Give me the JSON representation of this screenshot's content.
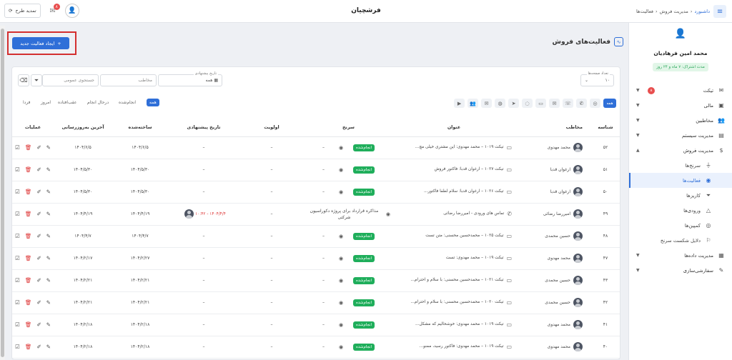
{
  "topbar": {
    "brand": "فرشچیان",
    "breadcrumb": [
      "داشبورد",
      "مدیریت فروش",
      "فعالیت‌ها"
    ],
    "update_label": "تمدید طرح",
    "mail_count": "۸"
  },
  "sidebar": {
    "user_name": "محمد امین فرهادیان",
    "user_status": "مدت اشتراک: ۷ ماه و ۲۴ روز",
    "items": [
      {
        "label": "تیکت",
        "icon": "ticket-icon",
        "badge": "۸"
      },
      {
        "label": "مالی",
        "icon": "finance-icon"
      },
      {
        "label": "مخاطبین",
        "icon": "contacts-icon"
      },
      {
        "label": "مدیریت سیستم",
        "icon": "system-icon"
      },
      {
        "label": "مدیریت فروش",
        "icon": "sales-icon"
      },
      {
        "label": "سرنخ‌ها",
        "icon": "funnel-icon"
      },
      {
        "label": "فعالیت‌ها",
        "icon": "lightbulb-icon"
      },
      {
        "label": "کاریزها",
        "icon": "pipeline-icon"
      },
      {
        "label": "ورودی‌ها",
        "icon": "inbox-icon"
      },
      {
        "label": "کمپین‌ها",
        "icon": "campaign-icon"
      },
      {
        "label": "دلایل شکست سرنخ",
        "icon": "flag-icon"
      },
      {
        "label": "مدیریت داده‌ها",
        "icon": "data-icon"
      },
      {
        "label": "سفارشی‌سازی",
        "icon": "customize-icon"
      }
    ]
  },
  "page": {
    "title": "فعالیت‌های فروش",
    "new_button": "ایجاد فعالیت جدید"
  },
  "filters": {
    "page_size_label": "تعداد صفحه‌ها",
    "page_size": "۱۰",
    "date_label": "تاریخ پیشنهادی",
    "date_value": "همه",
    "contact_placeholder": "مخاطب",
    "search_placeholder": "جستجوی عمومی"
  },
  "channels": {
    "all": "همه"
  },
  "status_tabs": [
    "همه",
    "انجام‌شده",
    "در‌حال انجام",
    "عقب‌افتاده",
    "امروز",
    "فردا"
  ],
  "table": {
    "headers": {
      "id": "شناسه",
      "contact": "مخاطب",
      "title": "عنوان",
      "lead": "سرنخ",
      "priority": "اولویت",
      "suggested": "تاریخ پیشنهادی",
      "created": "ساخته‌شده",
      "updated": "آخرین به‌روزرسانی",
      "ops": "عملیات"
    },
    "rows": [
      {
        "id": "۵۲",
        "contact": "محمد مهدوی",
        "title": "تیکت ۱۰۱۹ – محمد مهدوی: این مشتری خیلی مچ...",
        "status": "انجام‌شده",
        "lead": "–",
        "priority": "–",
        "suggested": "–",
        "created": "۱۴۰۴/۶/۵",
        "updated": "۱۴۰۴/۶/۵"
      },
      {
        "id": "۵۱",
        "contact": "ارغوان قدبا",
        "title": "تیکت ۱۰۲۷ – ارغوان قدبا: فاکتور فروش",
        "status": "انجام‌شده",
        "lead": "–",
        "priority": "–",
        "suggested": "–",
        "created": "۱۴۰۴/۵/۳۰",
        "updated": "۱۴۰۴/۵/۳۰"
      },
      {
        "id": "۵۰",
        "contact": "ارغوان قدبا",
        "title": "تیکت ۱۰۲۶ – ارغوان قدبا: سلام لطفا فاکتور...",
        "status": "انجام‌شده",
        "lead": "–",
        "priority": "–",
        "suggested": "–",
        "created": "۱۴۰۴/۵/۳۰",
        "updated": "۱۴۰۴/۵/۳۰"
      },
      {
        "id": "۴۹",
        "contact": "امیررضا رضائی",
        "title": "تماس های ورودی - امیررضا رضائی",
        "status": "",
        "lead": "مذاکره قرارداد برای پروژه دکوراسیون شرکتی",
        "priority": "–",
        "suggested": "۱۴۰۴/۴/۴ - ۱۰:۴۲",
        "created": "۱۴۰۴/۴/۱۹",
        "updated": "۱۴۰۴/۴/۱۹"
      },
      {
        "id": "۴۸",
        "contact": "حسین محمدی",
        "title": "تیکت ۱۰۲۵ – محمدحسین محسنی: متن تست",
        "status": "انجام‌شده",
        "lead": "–",
        "priority": "–",
        "suggested": "–",
        "created": "۱۴۰۴/۴/۷",
        "updated": "۱۴۰۴/۴/۷"
      },
      {
        "id": "۴۷",
        "contact": "محمد مهدوی",
        "title": "تیکت ۱۰۱۹ – محمد مهدوی: تست",
        "status": "انجام‌شده",
        "lead": "–",
        "priority": "–",
        "suggested": "–",
        "created": "۱۴۰۴/۲/۲۷",
        "updated": "۱۴۰۴/۲/۱۷"
      },
      {
        "id": "۴۳",
        "contact": "حسین محمدی",
        "title": "تیکت ۱۰۲۱ – محمدحسین محسنی: با سلام و احترام...",
        "status": "انجام‌شده",
        "lead": "–",
        "priority": "–",
        "suggested": "–",
        "created": "۱۴۰۴/۲/۲۱",
        "updated": "۱۴۰۴/۲/۲۱"
      },
      {
        "id": "۴۲",
        "contact": "حسین محمدی",
        "title": "تیکت ۱۰۲۰ – محمدحسین محسنی: با سلام و احترام...",
        "status": "انجام‌شده",
        "lead": "–",
        "priority": "–",
        "suggested": "–",
        "created": "۱۴۰۴/۲/۲۱",
        "updated": "۱۴۰۴/۲/۲۱"
      },
      {
        "id": "۴۱",
        "contact": "محمد مهدوی",
        "title": "تیکت ۱۰۱۹ – محمد مهدوی: خوشحالیم که مشکل...",
        "status": "انجام‌شده",
        "lead": "–",
        "priority": "–",
        "suggested": "–",
        "created": "۱۴۰۴/۲/۱۸",
        "updated": "۱۴۰۴/۲/۱۸"
      },
      {
        "id": "۴۰",
        "contact": "محمد مهدوی",
        "title": "تیکت ۱۰۱۹ – محمد مهدوی: فاکتور رسید، ممنو...",
        "status": "انجام‌شده",
        "lead": "–",
        "priority": "–",
        "suggested": "–",
        "created": "۱۴۰۴/۲/۱۸",
        "updated": "۱۴۰۴/۲/۱۸"
      }
    ]
  }
}
